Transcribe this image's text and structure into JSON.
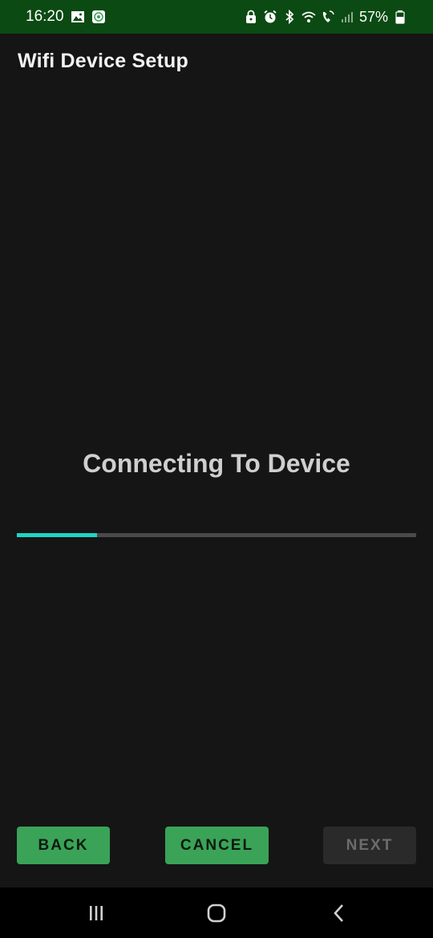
{
  "status_bar": {
    "time": "16:20",
    "battery": "57%",
    "icons_left": [
      "image-icon",
      "app-notification-icon"
    ],
    "icons_right": [
      "lock-icon",
      "alarm-icon",
      "bluetooth-icon",
      "wifi-icon",
      "wifi-call-icon",
      "signal-icon",
      "battery-icon"
    ]
  },
  "app_bar": {
    "title": "Wifi Device Setup"
  },
  "main": {
    "status_text": "Connecting To Device",
    "progress_fraction": 0.2
  },
  "buttons": {
    "back_label": "BACK",
    "cancel_label": "CANCEL",
    "next_label": "NEXT"
  },
  "nav_bar": {
    "icons": [
      "recent-apps-icon",
      "home-icon",
      "back-icon"
    ]
  },
  "colors": {
    "status_bar_bg": "#0b4a12",
    "background": "#151515",
    "accent_progress": "#1fd4c6",
    "button_green": "#3aa357",
    "button_disabled": "#2a2a2a"
  }
}
